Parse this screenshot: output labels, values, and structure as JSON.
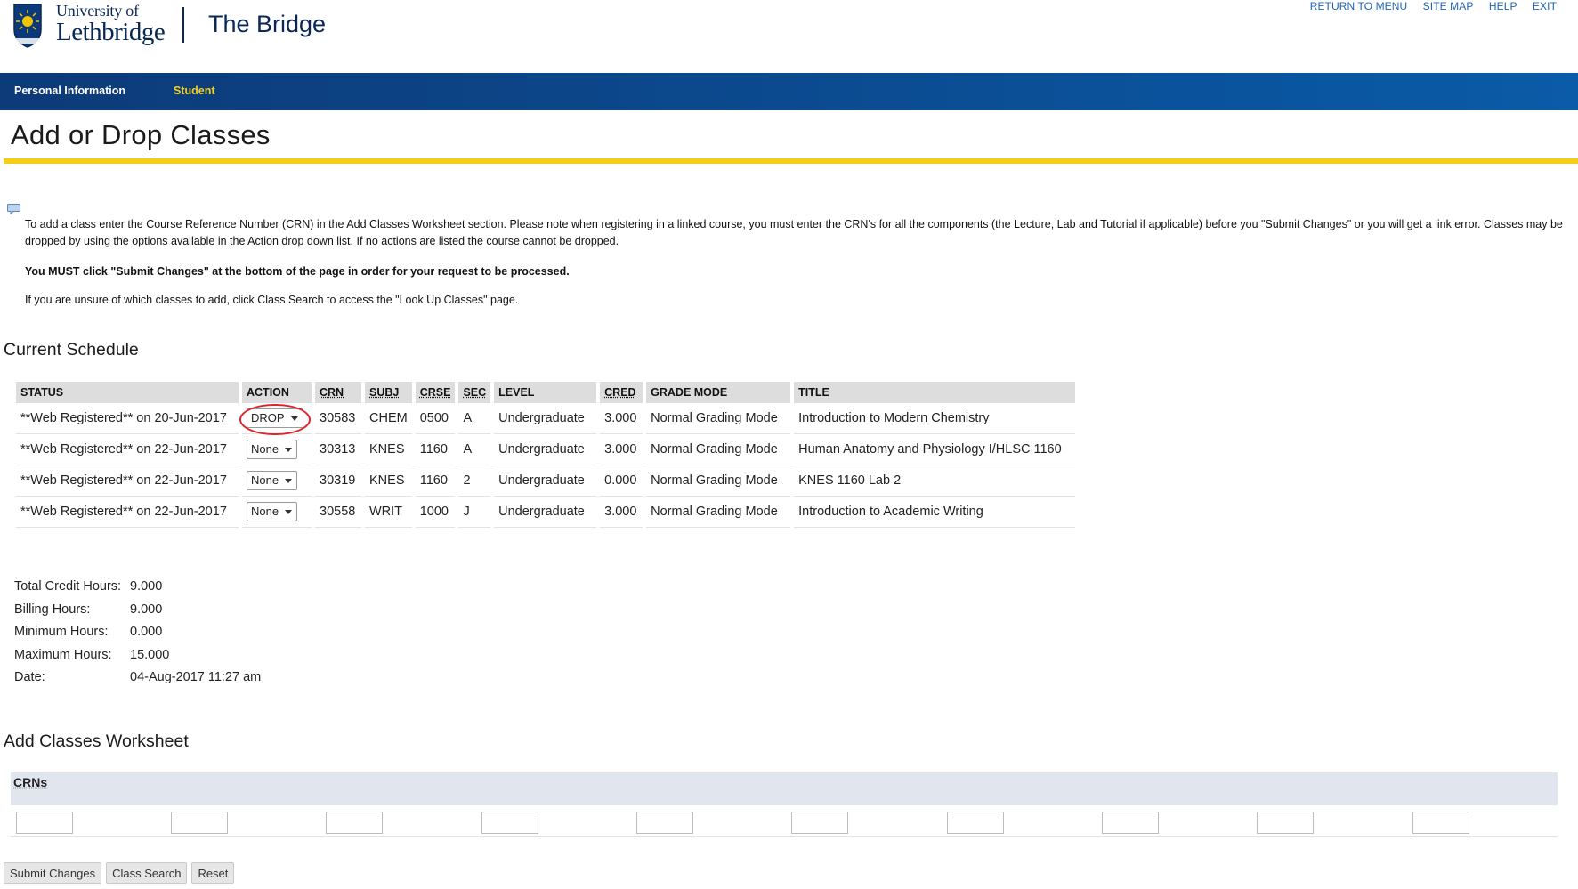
{
  "header": {
    "university_line1": "University of",
    "university_line2": "Lethbridge",
    "app_title": "The Bridge",
    "top_links": [
      "RETURN TO MENU",
      "SITE MAP",
      "HELP",
      "EXIT"
    ]
  },
  "nav": {
    "items": [
      {
        "label": "Personal Information",
        "active": false
      },
      {
        "label": "Student",
        "active": true
      }
    ]
  },
  "page": {
    "title": "Add or Drop Classes",
    "info_p1": "To add a class enter the Course Reference Number (CRN) in the Add Classes Worksheet section. Please note when registering in a linked course, you must enter the CRN's for all the components (the Lecture, Lab and Tutorial if applicable) before you \"Submit Changes\" or you will get a link error. Classes may be dropped by using the options available in the Action drop down list. If no actions are listed the course cannot be dropped.",
    "info_p2": "You MUST click \"Submit Changes\" at the bottom of the page in order for your request to be processed.",
    "info_p3": "If you are unsure of which classes to add, click Class Search to access the \"Look Up Classes\" page."
  },
  "schedule": {
    "section_title": "Current Schedule",
    "columns": [
      "STATUS",
      "ACTION",
      "CRN",
      "SUBJ",
      "CRSE",
      "SEC",
      "LEVEL",
      "CRED",
      "GRADE MODE",
      "TITLE"
    ],
    "rows": [
      {
        "status": "**Web Registered** on 20-Jun-2017",
        "action": "DROP",
        "crn": "30583",
        "subj": "CHEM",
        "crse": "0500",
        "sec": "A",
        "level": "Undergraduate",
        "cred": "3.000",
        "grade_mode": "Normal Grading Mode",
        "title": "Introduction to Modern Chemistry"
      },
      {
        "status": "**Web Registered** on 22-Jun-2017",
        "action": "None",
        "crn": "30313",
        "subj": "KNES",
        "crse": "1160",
        "sec": "A",
        "level": "Undergraduate",
        "cred": "3.000",
        "grade_mode": "Normal Grading Mode",
        "title": "Human Anatomy and Physiology I/HLSC 1160"
      },
      {
        "status": "**Web Registered** on 22-Jun-2017",
        "action": "None",
        "crn": "30319",
        "subj": "KNES",
        "crse": "1160",
        "sec": "2",
        "level": "Undergraduate",
        "cred": "0.000",
        "grade_mode": "Normal Grading Mode",
        "title": "KNES 1160 Lab 2"
      },
      {
        "status": "**Web Registered** on 22-Jun-2017",
        "action": "None",
        "crn": "30558",
        "subj": "WRIT",
        "crse": "1000",
        "sec": "J",
        "level": "Undergraduate",
        "cred": "3.000",
        "grade_mode": "Normal Grading Mode",
        "title": "Introduction to Academic Writing"
      }
    ]
  },
  "summary": [
    {
      "label": "Total Credit Hours:",
      "value": "9.000"
    },
    {
      "label": "Billing Hours:",
      "value": "9.000"
    },
    {
      "label": "Minimum Hours:",
      "value": "0.000"
    },
    {
      "label": "Maximum Hours:",
      "value": "15.000"
    },
    {
      "label": "Date:",
      "value": "04-Aug-2017 11:27 am"
    }
  ],
  "worksheet": {
    "section_title": "Add Classes Worksheet",
    "crns_label": "CRNs",
    "crn_values": [
      "",
      "",
      "",
      "",
      "",
      "",
      "",
      "",
      "",
      ""
    ]
  },
  "buttons": {
    "submit": "Submit Changes",
    "class_search": "Class Search",
    "reset": "Reset"
  },
  "colors": {
    "nav_blue": "#0b4a8f",
    "accent_yellow": "#f2cf1a",
    "link_blue": "#1d64b3",
    "highlight_red": "#e0222a"
  }
}
